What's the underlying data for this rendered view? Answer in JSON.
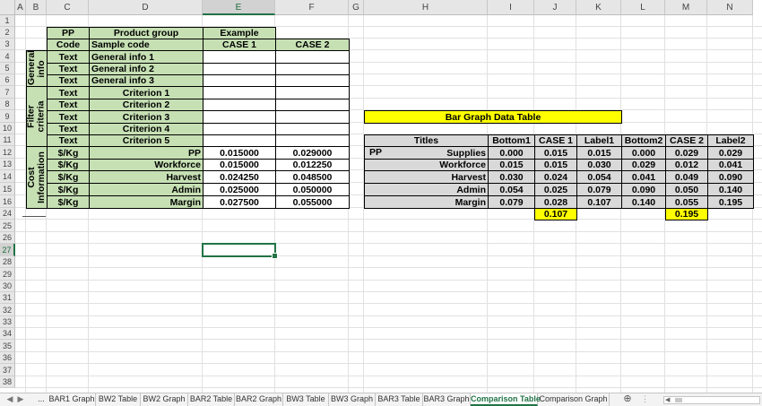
{
  "columns": [
    "A",
    "B",
    "C",
    "D",
    "E",
    "F",
    "G",
    "H",
    "I",
    "J",
    "K",
    "L",
    "M",
    "N"
  ],
  "selected_column": "E",
  "rows": [
    "1",
    "2",
    "3",
    "4",
    "5",
    "6",
    "7",
    "8",
    "9",
    "10",
    "11",
    "12",
    "13",
    "14",
    "15",
    "16",
    "24",
    "25",
    "26",
    "27",
    "28",
    "29",
    "30",
    "31",
    "32",
    "33",
    "34",
    "35",
    "36",
    "37",
    "38"
  ],
  "selected_row": "27",
  "left_table": {
    "hdr_pp": "PP",
    "hdr_product_group": "Product group",
    "hdr_example": "Example",
    "hdr_code": "Code",
    "hdr_sample_code": "Sample code",
    "hdr_case1": "CASE 1",
    "hdr_case2": "CASE 2",
    "section_general": "General info",
    "section_filter": "Filter criteria",
    "section_cost": "Cost Information",
    "rows": [
      {
        "c": "Text",
        "d": "General info 1",
        "e": "",
        "f": ""
      },
      {
        "c": "Text",
        "d": "General info 2",
        "e": "",
        "f": ""
      },
      {
        "c": "Text",
        "d": "General info 3",
        "e": "",
        "f": ""
      },
      {
        "c": "Text",
        "d": "Criterion 1",
        "e": "",
        "f": ""
      },
      {
        "c": "Text",
        "d": "Criterion 2",
        "e": "",
        "f": ""
      },
      {
        "c": "Text",
        "d": "Criterion 3",
        "e": "",
        "f": ""
      },
      {
        "c": "Text",
        "d": "Criterion 4",
        "e": "",
        "f": ""
      },
      {
        "c": "Text",
        "d": "Criterion 5",
        "e": "",
        "f": ""
      },
      {
        "c": "$/Kg",
        "d": "PP",
        "e": "0.015000",
        "f": "0.029000"
      },
      {
        "c": "$/Kg",
        "d": "Workforce",
        "e": "0.015000",
        "f": "0.012250"
      },
      {
        "c": "$/Kg",
        "d": "Harvest",
        "e": "0.024250",
        "f": "0.048500"
      },
      {
        "c": "$/Kg",
        "d": "Admin",
        "e": "0.025000",
        "f": "0.050000"
      },
      {
        "c": "$/Kg",
        "d": "Margin",
        "e": "0.027500",
        "f": "0.055000"
      }
    ]
  },
  "right_table": {
    "title": "Bar Graph Data Table",
    "headers": [
      "Titles",
      "Bottom1",
      "CASE 1",
      "Label1",
      "Bottom2",
      "CASE 2",
      "Label2"
    ],
    "rows": [
      {
        "pre": "PP",
        "title": "Supplies",
        "b1": "0.000",
        "c1": "0.015",
        "l1": "0.015",
        "b2": "0.000",
        "c2": "0.029",
        "l2": "0.029"
      },
      {
        "pre": "",
        "title": "Workforce",
        "b1": "0.015",
        "c1": "0.015",
        "l1": "0.030",
        "b2": "0.029",
        "c2": "0.012",
        "l2": "0.041"
      },
      {
        "pre": "",
        "title": "Harvest",
        "b1": "0.030",
        "c1": "0.024",
        "l1": "0.054",
        "b2": "0.041",
        "c2": "0.049",
        "l2": "0.090"
      },
      {
        "pre": "",
        "title": "Admin",
        "b1": "0.054",
        "c1": "0.025",
        "l1": "0.079",
        "b2": "0.090",
        "c2": "0.050",
        "l2": "0.140"
      },
      {
        "pre": "",
        "title": "Margin",
        "b1": "0.079",
        "c1": "0.028",
        "l1": "0.107",
        "b2": "0.140",
        "c2": "0.055",
        "l2": "0.195"
      }
    ],
    "total_case1": "0.107",
    "total_case2": "0.195"
  },
  "tabs": {
    "ellipsis": "...",
    "items": [
      "BAR1 Graph",
      "BW2 Table",
      "BW2 Graph",
      "BAR2 Table",
      "BAR2 Graph",
      "BW3 Table",
      "BW3 Graph",
      "BAR3 Table",
      "BAR3 Graph",
      "Comparison Table",
      "Comparison Graph"
    ],
    "active": "Comparison Table",
    "add_symbol": "⊕",
    "prev_symbol": "◀",
    "next_symbol": "▶"
  },
  "colors": {
    "header_green": "#c6e0b4",
    "highlight_yellow": "#ffff00",
    "data_gray": "#d9d9d9",
    "excel_accent": "#217346"
  }
}
